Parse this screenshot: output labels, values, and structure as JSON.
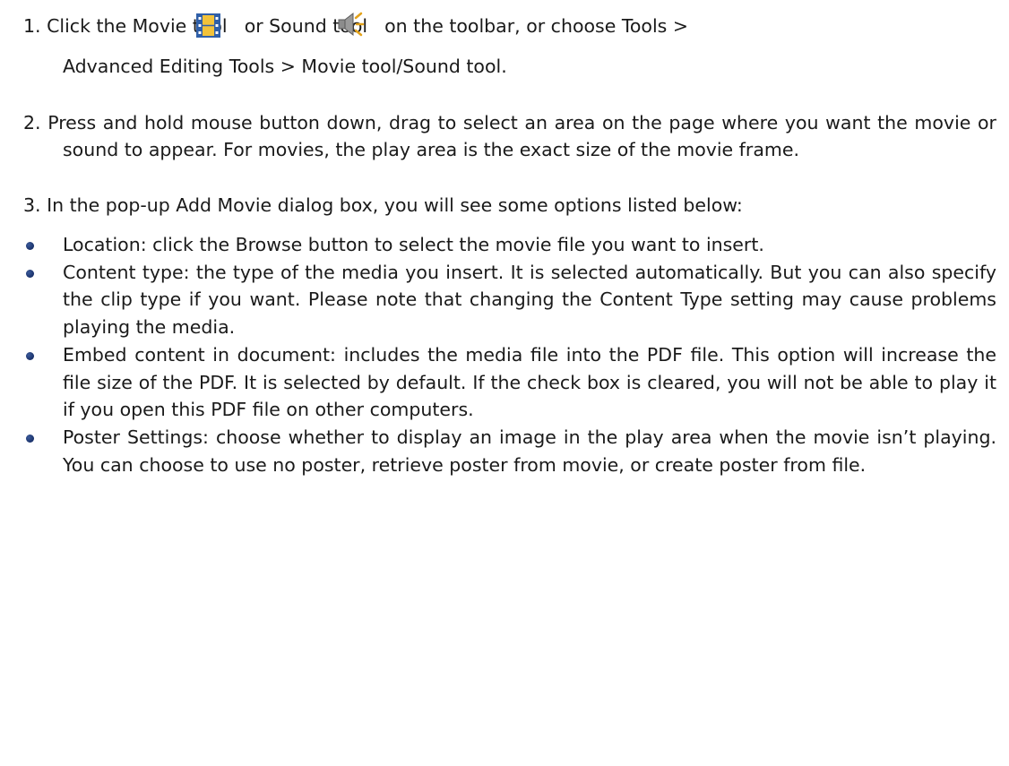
{
  "steps": [
    {
      "number": "1.",
      "text_before_movie_icon": "Click the Movie tool",
      "movie_icon": "movie-tool-icon",
      "text_between_icons": "or Sound tool",
      "sound_icon": "sound-tool-icon",
      "text_after_sound_icon": "on the toolbar, or choose Tools >",
      "text_line2": "Advanced Editing Tools > Movie tool/Sound tool."
    },
    {
      "number": "2.",
      "text": "Press and hold mouse button down, drag to select an area on the page where you want the movie or sound to appear. For movies, the play area is the exact size of the movie frame."
    },
    {
      "number": "3.",
      "text": "In the pop-up Add Movie dialog box, you will see some options listed below:"
    }
  ],
  "options": [
    "Location: click the Browse button to select the movie file you want to insert.",
    "Content type: the type of the media you insert. It is selected automatically. But you can also specify the clip type if you want. Please note that changing the Content Type setting may cause problems playing the media.",
    "Embed content in document: includes the media file into the PDF file. This option will increase the file size of the PDF. It is selected by default. If the check box is cleared, you will not be able to play it if you open this PDF file on other computers.",
    "Poster Settings: choose whether to display an image in the play area when the movie isn’t playing. You can choose to use no poster, retrieve poster from movie, or create poster from file."
  ],
  "colors": {
    "text": "#1a1a1a",
    "bullet": "#0b1f55",
    "movie_icon_fill": "#f2c23a",
    "movie_icon_frame": "#2f5fa8",
    "sound_icon_speaker": "#7a7a7a",
    "sound_icon_waves": "#e3a21a"
  }
}
